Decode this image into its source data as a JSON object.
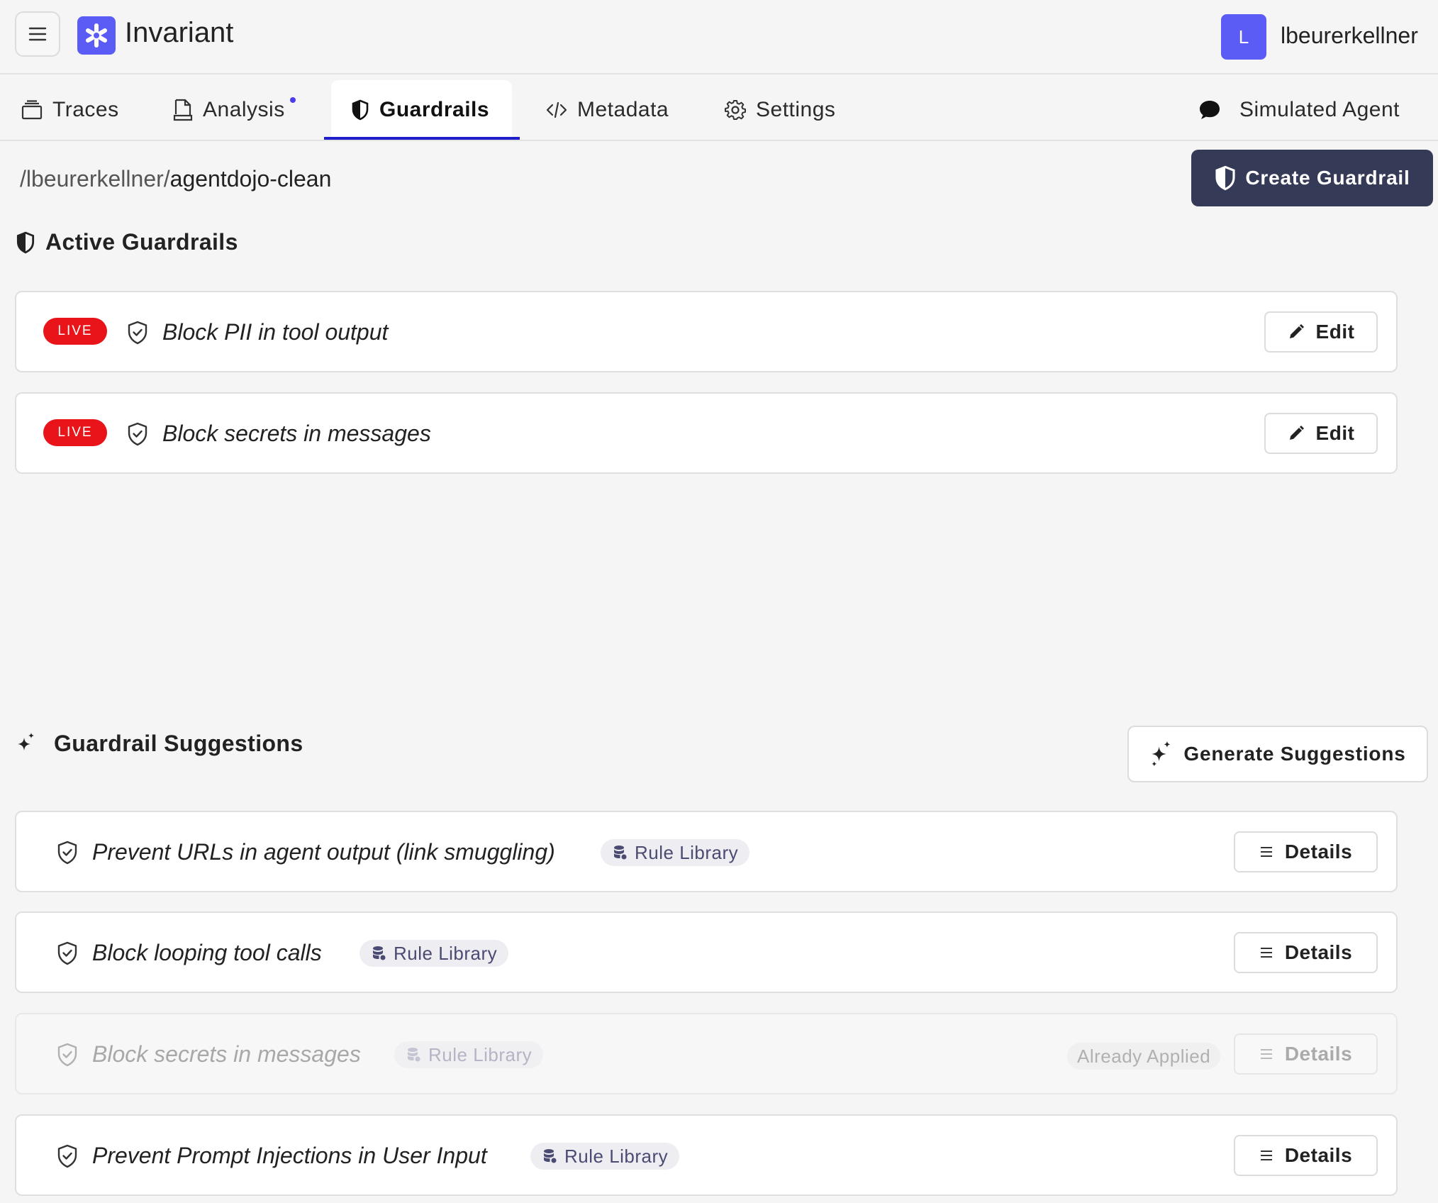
{
  "app": {
    "name": "Invariant",
    "user_initial": "L",
    "username": "lbeurerkellner"
  },
  "tabs": [
    {
      "label": "Traces",
      "icon": "stack-icon"
    },
    {
      "label": "Analysis",
      "icon": "document-icon",
      "has_dot": true
    },
    {
      "label": "Guardrails",
      "icon": "shield-icon",
      "active": true
    },
    {
      "label": "Metadata",
      "icon": "code-icon"
    },
    {
      "label": "Settings",
      "icon": "gear-icon"
    }
  ],
  "simulated_agent": {
    "label": "Simulated Agent",
    "icon": "chat-bubble-icon"
  },
  "breadcrumb": {
    "owner": "/lbeurerkellner/",
    "project": "agentdojo-clean"
  },
  "create_button": {
    "label": "Create Guardrail"
  },
  "active_section": {
    "title": "Active Guardrails",
    "items": [
      {
        "status": "LIVE",
        "title": "Block PII in tool output",
        "action": "Edit"
      },
      {
        "status": "LIVE",
        "title": "Block secrets in messages",
        "action": "Edit"
      }
    ]
  },
  "suggestions_section": {
    "title": "Guardrail Suggestions",
    "generate_label": "Generate Suggestions",
    "items": [
      {
        "title": "Prevent URLs in agent output (link smuggling)",
        "tag": "Rule Library",
        "action": "Details"
      },
      {
        "title": "Block looping tool calls",
        "tag": "Rule Library",
        "action": "Details"
      },
      {
        "title": "Block secrets in messages",
        "tag": "Rule Library",
        "status": "Already Applied",
        "action": "Details",
        "disabled": true
      },
      {
        "title": "Prevent Prompt Injections in User Input",
        "tag": "Rule Library",
        "action": "Details"
      }
    ]
  },
  "colors": {
    "brand": "#5b5cf6",
    "live": "#e8141a",
    "primary_button": "#353a57",
    "active_tab_underline": "#1e1ecb"
  }
}
